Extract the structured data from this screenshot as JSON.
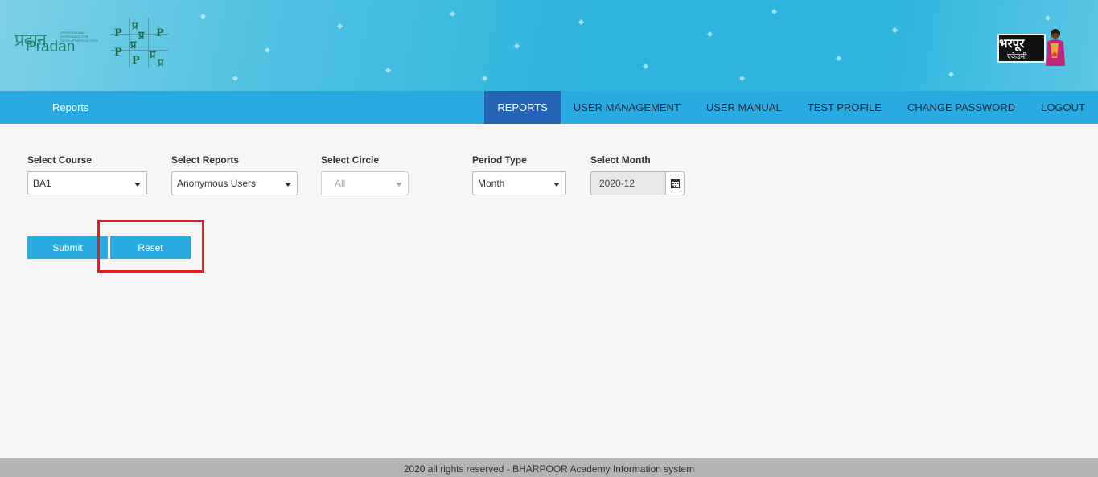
{
  "header": {
    "pradan_logo": {
      "hindi": "प्रदान",
      "latin": "Pradan",
      "tagline": "PROFESSIONAL ASSISTANCE FOR DEVELOPMENT ACTION"
    },
    "grid_logo": {
      "letters": [
        "प्र",
        "P",
        "प्र",
        "P",
        "प्र",
        "P",
        "प्र",
        "P",
        "प्र"
      ]
    },
    "bharpoor_logo": {
      "word": "भरपूर",
      "sub": "एकेडमी"
    }
  },
  "nav": {
    "brand": "Reports",
    "items": [
      {
        "label": "REPORTS",
        "active": true
      },
      {
        "label": "USER MANAGEMENT"
      },
      {
        "label": "USER MANUAL"
      },
      {
        "label": "TEST PROFILE"
      },
      {
        "label": "CHANGE PASSWORD"
      },
      {
        "label": "LOGOUT"
      }
    ]
  },
  "form": {
    "course": {
      "label": "Select Course",
      "value": "BA1"
    },
    "reports": {
      "label": "Select Reports",
      "value": "Anonymous Users"
    },
    "circle": {
      "label": "Select Circle",
      "value": "All"
    },
    "period": {
      "label": "Period Type",
      "value": "Month"
    },
    "month": {
      "label": "Select Month",
      "value": "2020-12"
    },
    "submit_label": "Submit",
    "reset_label": "Reset"
  },
  "colors": {
    "accent": "#29abe2",
    "nav_active": "#2464b4",
    "highlight": "#e02020"
  },
  "footer": {
    "text": "2020 all rights reserved - BHARPOOR Academy Information system"
  }
}
